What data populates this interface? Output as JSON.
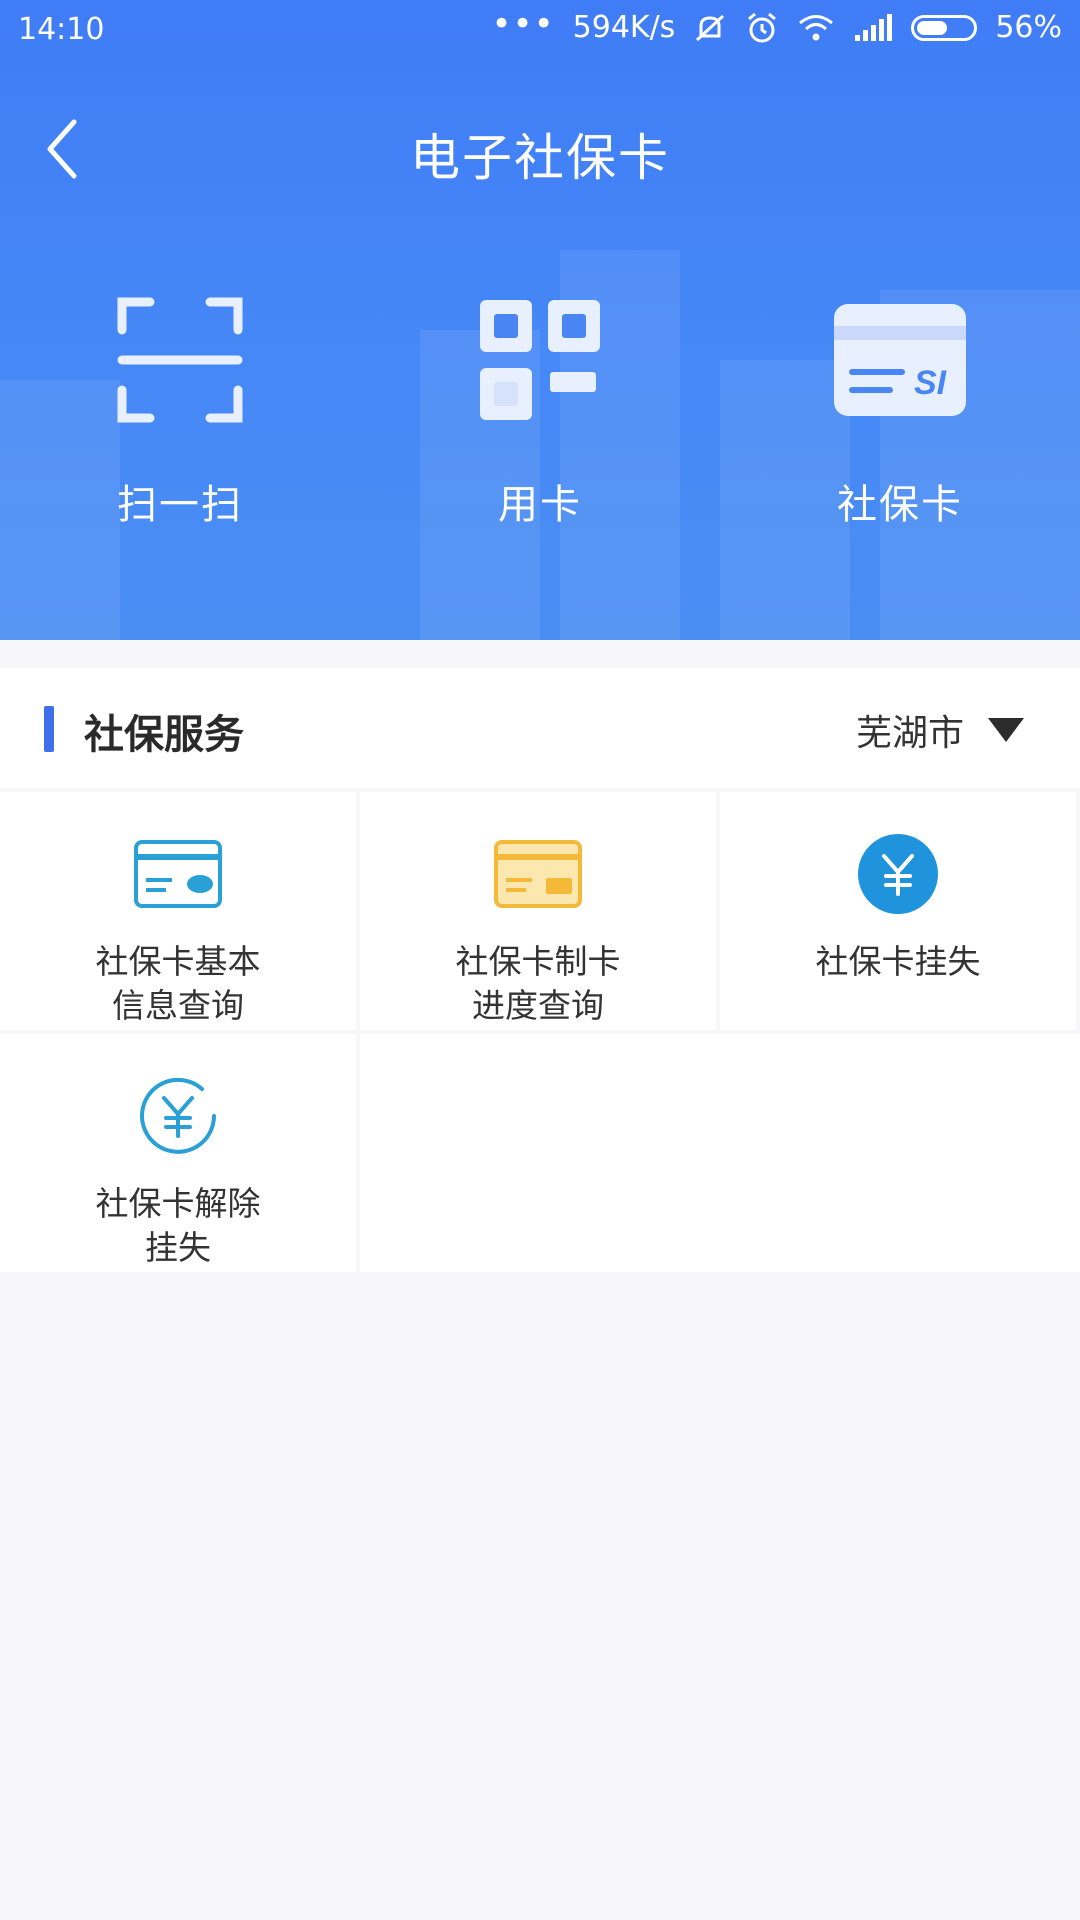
{
  "status_bar": {
    "time": "14:10",
    "dots": "•••",
    "network_speed": "594K/s",
    "battery": "56%"
  },
  "nav": {
    "title": "电子社保卡",
    "back_icon": "chevron-left-icon"
  },
  "quick_actions": [
    {
      "label": "扫一扫",
      "icon": "scan-icon"
    },
    {
      "label": "用卡",
      "icon": "qr-code-icon"
    },
    {
      "label": "社保卡",
      "icon": "card-icon"
    }
  ],
  "section": {
    "title": "社保服务",
    "city": "芜湖市",
    "accent": "#3f6fea"
  },
  "services": [
    {
      "line1": "社保卡基本",
      "line2": "信息查询",
      "icon": "card-info-icon",
      "color": "#2aa0d6"
    },
    {
      "line1": "社保卡制卡",
      "line2": "进度查询",
      "icon": "card-progress-icon",
      "color": "#f5b93a"
    },
    {
      "line1": "社保卡挂失",
      "line2": "",
      "icon": "yuan-icon",
      "color": "#1f93db"
    },
    {
      "line1": "社保卡解除",
      "line2": "挂失",
      "icon": "yuan-outline-icon",
      "color": "#2aa0d6"
    }
  ]
}
